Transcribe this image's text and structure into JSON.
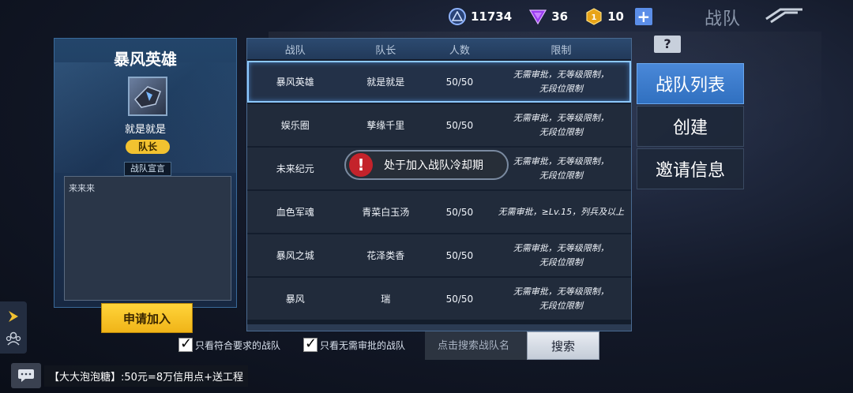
{
  "topbar": {
    "currencies": [
      {
        "icon": "star-coin-icon",
        "value": "11734",
        "color": "#8fb4ff"
      },
      {
        "icon": "purple-gem-icon",
        "value": "36",
        "color": "#b04dff"
      },
      {
        "icon": "gold-token-icon",
        "value": "10",
        "color": "#f0b020"
      }
    ],
    "add_label": "+",
    "title": "战队"
  },
  "team_info": {
    "name": "暴风英雄",
    "leader": "就是就是",
    "leader_badge": "队长",
    "declaration_tab": "战队宣言",
    "declaration_text": "来来来",
    "apply_button": "申请加入"
  },
  "table": {
    "headers": [
      "战队",
      "队长",
      "人数",
      "限制"
    ],
    "rows": [
      {
        "team": "暴风英雄",
        "leader": "就是就是",
        "members": "50/50",
        "limit_line1": "无需审批，无等级限制，",
        "limit_line2": "无段位限制",
        "selected": true
      },
      {
        "team": "娱乐圈",
        "leader": "孳缘千里",
        "members": "50/50",
        "limit_line1": "无需审批，无等级限制，",
        "limit_line2": "无段位限制",
        "selected": false
      },
      {
        "team": "未来纪元",
        "leader": "",
        "members": "",
        "limit_line1": "无需审批，无等级限制，",
        "limit_line2": "无段位限制",
        "selected": false
      },
      {
        "team": "血色军魂",
        "leader": "青菜白玉汤",
        "members": "50/50",
        "limit_line1": "无需审批，≥Lv.15，列兵及以上",
        "limit_line2": "",
        "selected": false
      },
      {
        "team": "暴风之城",
        "leader": "花泽类香",
        "members": "50/50",
        "limit_line1": "无需审批，无等级限制，",
        "limit_line2": "无段位限制",
        "selected": false
      },
      {
        "team": "暴风",
        "leader": "瑞",
        "members": "50/50",
        "limit_line1": "无需审批，无等级限制，",
        "limit_line2": "无段位限制",
        "selected": false
      }
    ]
  },
  "toast": {
    "icon": "!",
    "text": "处于加入战队冷却期"
  },
  "menu": {
    "help": "?",
    "items": [
      "战队列表",
      "创建",
      "邀请信息"
    ],
    "active_index": 0
  },
  "filters": {
    "qualified_only": "只看符合要求的战队",
    "no_approval_only": "只看无需审批的战队",
    "search_placeholder": "点击搜索战队名",
    "search_button": "搜索"
  },
  "chat": {
    "message": "【大大泡泡糖】:50元=8万信用点+送工程"
  }
}
